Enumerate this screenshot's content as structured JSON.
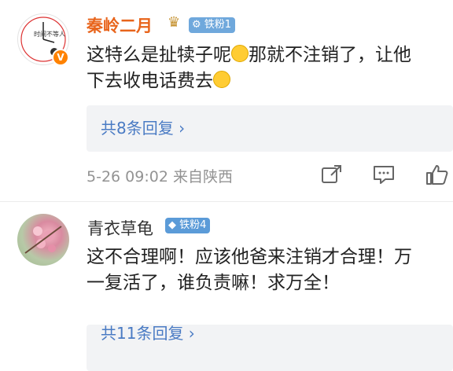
{
  "comments": [
    {
      "username": "秦岭二月",
      "fan_badge": "铁粉1",
      "text_line1": "这特么是扯犊子呢",
      "text_line1b": "那就不注销了，让他",
      "text_line2": "下去收电话费去",
      "replies_label": "共8条回复 ›",
      "time": "5-26 09:02",
      "location": "来自陕西",
      "avatar_text": "时间不等人",
      "verified_mark": "V"
    },
    {
      "username": "青衣草龟",
      "fan_badge": "铁粉4",
      "text_line1": "这不合理啊！应该他爸来注销才合理！万",
      "text_line2": "一复活了，谁负责嘛！求万全！",
      "replies_label": "共11条回复 ›"
    }
  ],
  "icons": [
    "share-icon",
    "comment-icon",
    "like-icon",
    "crown-icon",
    "diamond-icon",
    "laugh-cry-emoji"
  ],
  "colors": {
    "username_vip": "#e8641b",
    "reply_link": "#4a7bc4",
    "badge": "#6fa8dc",
    "meta": "#939393"
  }
}
